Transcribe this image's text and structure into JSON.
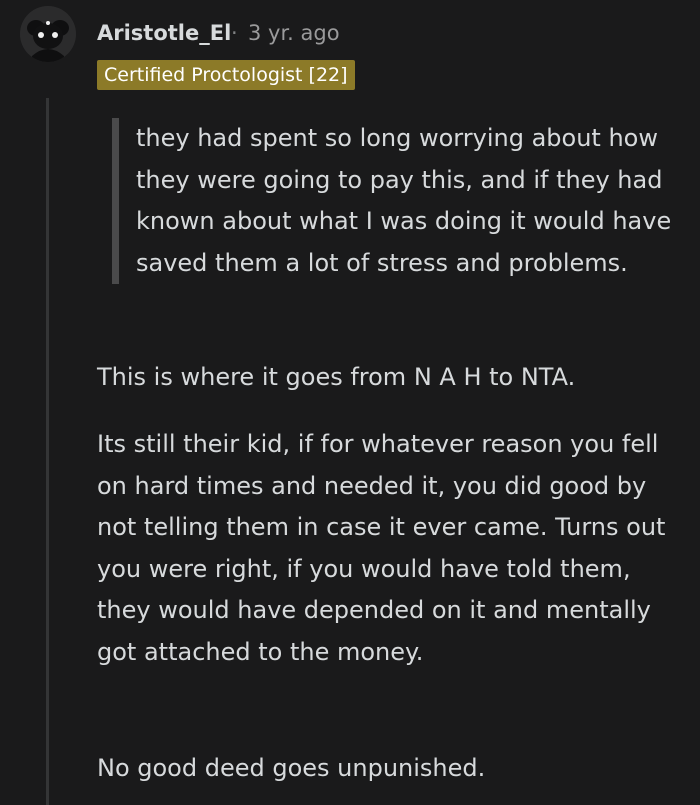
{
  "comment": {
    "author": "Aristotle_El",
    "separator": "·",
    "timestamp": "3 yr. ago",
    "flair": "Certified Proctologist [22]",
    "quote": "they had spent so long worrying about how they were going to pay this, and if they had known about what I was doing it would have saved them a lot of stress and problems.",
    "paragraphs": [
      "This is where it goes from N A H to NTA.",
      "Its still their kid, if for whatever reason you fell on hard times and needed it, you did good by not telling them in case it ever came. Turns out you were right, if you would have told them, they would have depended on it and mentally got attached to the money.",
      "No good deed goes unpunished."
    ]
  },
  "colors": {
    "background": "#1a1a1b",
    "flair_background": "#8c7a28",
    "text": "#d7dadc",
    "meta": "#9a9a9b"
  },
  "icons": {
    "avatar": "snoo-avatar-icon"
  }
}
